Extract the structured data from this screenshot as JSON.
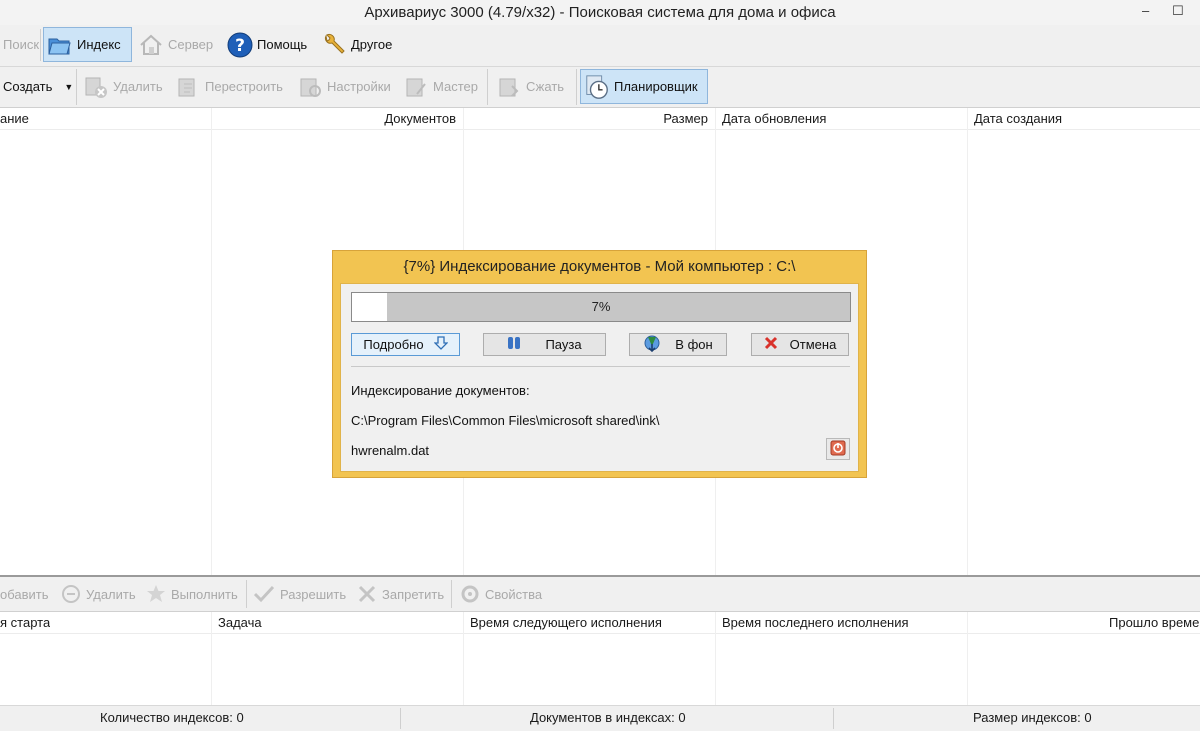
{
  "window": {
    "title": "Архивариус 3000 (4.79/x32) - Поисковая система для дома и офиса",
    "minimize": "–",
    "maximize": "☐"
  },
  "main_toolbar": {
    "search": "Поиск",
    "index": "Индекс",
    "server": "Сервер",
    "help": "Помощь",
    "other": "Другое"
  },
  "index_toolbar": {
    "create": "Создать",
    "delete": "Удалить",
    "rebuild": "Перестроить",
    "settings": "Настройки",
    "wizard": "Мастер",
    "compress": "Сжать",
    "scheduler": "Планировщик"
  },
  "index_table": {
    "columns": [
      "ание",
      "Документов",
      "Размер",
      "Дата обновления",
      "Дата создания"
    ]
  },
  "task_toolbar": {
    "add": "обавить",
    "delete": "Удалить",
    "run": "Выполнить",
    "enable": "Разрешить",
    "disable": "Запретить",
    "properties": "Свойства"
  },
  "task_table": {
    "columns": [
      "я старта",
      "Задача",
      "Время следующего исполнения",
      "Время последнего исполнения",
      "Прошло времен"
    ]
  },
  "status_bar": {
    "index_count": "Количество индексов: 0",
    "docs_in_indexes": "Документов в индексах: 0",
    "index_size": "Размер индексов: 0"
  },
  "dialog": {
    "title": "{7%} Индексирование документов - Мой компьютер : C:\\",
    "progress_percent": 7,
    "progress_label": "7%",
    "details_button": "Подробно",
    "pause_button": "Пауза",
    "background_button": "В фон",
    "cancel_button": "Отмена",
    "status_line": "Индексирование документов:",
    "current_path": "C:\\Program Files\\Common Files\\microsoft shared\\ink\\",
    "current_file": "hwrenalm.dat"
  },
  "colors": {
    "dialog_frame": "#f2c451",
    "active_button": "#cde4f7",
    "progress_track": "#c6c6c6",
    "cancel_red": "#d9322b",
    "help_blue": "#1f5fb8"
  }
}
